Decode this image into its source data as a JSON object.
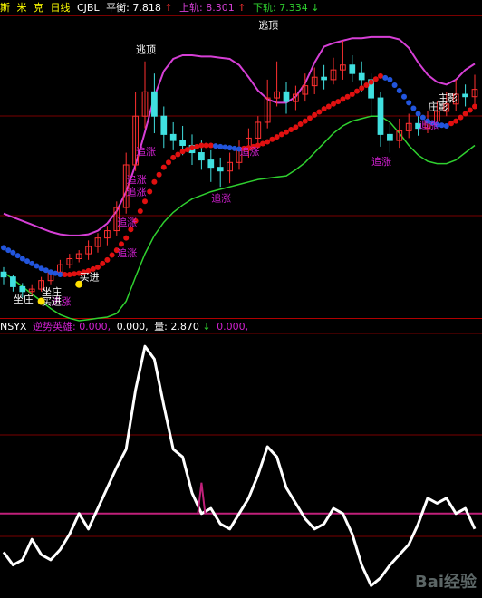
{
  "header": {
    "name_chars": [
      "斯",
      "米",
      "克"
    ],
    "period": "日线",
    "indicator": "CJBL",
    "balance_label": "平衡:",
    "balance_value": "7.818",
    "balance_arrow": "↑",
    "upper_label": "上轨:",
    "upper_value": "8.301",
    "upper_arrow": "↑",
    "lower_label": "下轨:",
    "lower_value": "7.334",
    "lower_arrow": "↓"
  },
  "sub_header": {
    "indicator": "NSYX",
    "name_label": "逆势英雄:",
    "v1": "0.000,",
    "v2": "0.000,",
    "vol_label": "量:",
    "vol_value": "2.870",
    "vol_arrow": "↓",
    "v4": "0.000,"
  },
  "colors": {
    "upper_band": "#d63fd6",
    "lower_band": "#2fd02f",
    "mid_up": "#e01010",
    "mid_down": "#2255dd",
    "candle_up": "#ff3030",
    "candle_down": "#40e0e0",
    "signal_text": "#d020d0",
    "buy_dot": "#ffe000",
    "osc_line": "#ffffff",
    "ref_line": "#c0207a",
    "grid": "#7a0000"
  },
  "annotations": [
    {
      "text": "逃顶",
      "color": "#ffffff"
    },
    {
      "text": "逃顶",
      "color": "#ffffff"
    },
    {
      "text": "追涨",
      "color": "#d020d0"
    },
    {
      "text": "追涨",
      "color": "#d020d0"
    },
    {
      "text": "追涨",
      "color": "#d020d0"
    },
    {
      "text": "追涨",
      "color": "#d020d0"
    },
    {
      "text": "追涨",
      "color": "#d020d0"
    },
    {
      "text": "追涨",
      "color": "#d020d0"
    },
    {
      "text": "追涨",
      "color": "#d020d0"
    },
    {
      "text": "追涨",
      "color": "#d020d0"
    },
    {
      "text": "追涨",
      "color": "#d020d0"
    },
    {
      "text": "追涨",
      "color": "#d020d0"
    },
    {
      "text": "买进",
      "color": "#ffffff"
    },
    {
      "text": "买进",
      "color": "#ffffff"
    },
    {
      "text": "坐庄",
      "color": "#ffffff"
    },
    {
      "text": "坐庄",
      "color": "#ffffff"
    },
    {
      "text": "庄影",
      "color": "#ffffff"
    },
    {
      "text": "庄影",
      "color": "#ffffff"
    }
  ],
  "watermark": "Bai经验",
  "chart_data": [
    {
      "type": "line",
      "indicator": "CJBL",
      "series": [
        {
          "name": "上轨",
          "last": 8.301
        },
        {
          "name": "平衡",
          "last": 7.818
        },
        {
          "name": "下轨",
          "last": 7.334
        }
      ],
      "upper": [
        7.3,
        7.27,
        7.24,
        7.21,
        7.18,
        7.15,
        7.13,
        7.12,
        7.12,
        7.13,
        7.16,
        7.22,
        7.32,
        7.48,
        7.7,
        7.97,
        8.26,
        8.47,
        8.57,
        8.6,
        8.6,
        8.59,
        8.59,
        8.58,
        8.57,
        8.52,
        8.42,
        8.31,
        8.24,
        8.21,
        8.21,
        8.26,
        8.37,
        8.54,
        8.67,
        8.7,
        8.72,
        8.74,
        8.74,
        8.75,
        8.75,
        8.75,
        8.73,
        8.66,
        8.54,
        8.44,
        8.38,
        8.36,
        8.4,
        8.48,
        8.53
      ],
      "mid": [
        7.02,
        6.98,
        6.93,
        6.89,
        6.85,
        6.82,
        6.8,
        6.8,
        6.81,
        6.83,
        6.86,
        6.92,
        7.0,
        7.1,
        7.24,
        7.4,
        7.56,
        7.68,
        7.76,
        7.81,
        7.84,
        7.86,
        7.86,
        7.85,
        7.84,
        7.83,
        7.84,
        7.86,
        7.89,
        7.93,
        7.97,
        8.01,
        8.06,
        8.11,
        8.16,
        8.2,
        8.24,
        8.28,
        8.33,
        8.38,
        8.43,
        8.4,
        8.31,
        8.21,
        8.12,
        8.06,
        8.03,
        8.02,
        8.06,
        8.12,
        8.18
      ],
      "lower": [
        6.82,
        6.76,
        6.7,
        6.64,
        6.58,
        6.52,
        6.47,
        6.44,
        6.42,
        6.43,
        6.44,
        6.45,
        6.48,
        6.58,
        6.78,
        6.97,
        7.12,
        7.23,
        7.31,
        7.37,
        7.42,
        7.45,
        7.48,
        7.5,
        7.52,
        7.54,
        7.56,
        7.58,
        7.59,
        7.6,
        7.61,
        7.66,
        7.72,
        7.8,
        7.88,
        7.96,
        8.02,
        8.06,
        8.08,
        8.1,
        8.1,
        8.05,
        7.96,
        7.86,
        7.78,
        7.73,
        7.71,
        7.71,
        7.74,
        7.8,
        7.86
      ],
      "candles": [
        {
          "o": 6.82,
          "c": 6.78,
          "h": 6.86,
          "l": 6.72
        },
        {
          "o": 6.78,
          "c": 6.7,
          "h": 6.8,
          "l": 6.66
        },
        {
          "o": 6.7,
          "c": 6.66,
          "h": 6.73,
          "l": 6.61
        },
        {
          "o": 6.66,
          "c": 6.68,
          "h": 6.72,
          "l": 6.62
        },
        {
          "o": 6.68,
          "c": 6.75,
          "h": 6.78,
          "l": 6.66
        },
        {
          "o": 6.75,
          "c": 6.82,
          "h": 6.84,
          "l": 6.72
        },
        {
          "o": 6.82,
          "c": 6.88,
          "h": 6.92,
          "l": 6.78
        },
        {
          "o": 6.88,
          "c": 6.93,
          "h": 6.97,
          "l": 6.85
        },
        {
          "o": 6.93,
          "c": 6.97,
          "h": 7.0,
          "l": 6.9
        },
        {
          "o": 6.97,
          "c": 7.03,
          "h": 7.08,
          "l": 6.92
        },
        {
          "o": 7.03,
          "c": 7.1,
          "h": 7.14,
          "l": 6.98
        },
        {
          "o": 7.1,
          "c": 7.16,
          "h": 7.2,
          "l": 7.04
        },
        {
          "o": 7.16,
          "c": 7.35,
          "h": 7.4,
          "l": 7.12
        },
        {
          "o": 7.35,
          "c": 7.7,
          "h": 7.8,
          "l": 7.3
        },
        {
          "o": 7.7,
          "c": 8.1,
          "h": 8.3,
          "l": 7.65
        },
        {
          "o": 8.1,
          "c": 8.3,
          "h": 8.55,
          "l": 8.0
        },
        {
          "o": 8.3,
          "c": 8.1,
          "h": 8.45,
          "l": 7.96
        },
        {
          "o": 8.1,
          "c": 7.95,
          "h": 8.18,
          "l": 7.84
        },
        {
          "o": 7.95,
          "c": 7.9,
          "h": 8.05,
          "l": 7.82
        },
        {
          "o": 7.9,
          "c": 7.86,
          "h": 8.02,
          "l": 7.78
        },
        {
          "o": 7.86,
          "c": 7.8,
          "h": 7.95,
          "l": 7.7
        },
        {
          "o": 7.8,
          "c": 7.74,
          "h": 7.9,
          "l": 7.66
        },
        {
          "o": 7.74,
          "c": 7.68,
          "h": 7.82,
          "l": 7.56
        },
        {
          "o": 7.68,
          "c": 7.65,
          "h": 7.76,
          "l": 7.52
        },
        {
          "o": 7.65,
          "c": 7.72,
          "h": 7.8,
          "l": 7.55
        },
        {
          "o": 7.72,
          "c": 7.82,
          "h": 7.9,
          "l": 7.66
        },
        {
          "o": 7.82,
          "c": 7.92,
          "h": 8.0,
          "l": 7.76
        },
        {
          "o": 7.92,
          "c": 8.05,
          "h": 8.1,
          "l": 7.85
        },
        {
          "o": 8.05,
          "c": 8.25,
          "h": 8.4,
          "l": 8.0
        },
        {
          "o": 8.25,
          "c": 8.3,
          "h": 8.55,
          "l": 8.18
        },
        {
          "o": 8.3,
          "c": 8.22,
          "h": 8.38,
          "l": 8.12
        },
        {
          "o": 8.22,
          "c": 8.28,
          "h": 8.35,
          "l": 8.15
        },
        {
          "o": 8.28,
          "c": 8.35,
          "h": 8.45,
          "l": 8.22
        },
        {
          "o": 8.35,
          "c": 8.42,
          "h": 8.5,
          "l": 8.28
        },
        {
          "o": 8.42,
          "c": 8.4,
          "h": 8.52,
          "l": 8.32
        },
        {
          "o": 8.4,
          "c": 8.48,
          "h": 8.58,
          "l": 8.36
        },
        {
          "o": 8.48,
          "c": 8.52,
          "h": 8.72,
          "l": 8.4
        },
        {
          "o": 8.52,
          "c": 8.45,
          "h": 8.6,
          "l": 8.38
        },
        {
          "o": 8.45,
          "c": 8.4,
          "h": 8.55,
          "l": 8.3
        },
        {
          "o": 8.4,
          "c": 8.25,
          "h": 8.45,
          "l": 8.1
        },
        {
          "o": 8.25,
          "c": 7.95,
          "h": 8.3,
          "l": 7.85
        },
        {
          "o": 7.95,
          "c": 7.9,
          "h": 8.05,
          "l": 7.8
        },
        {
          "o": 7.9,
          "c": 7.98,
          "h": 8.08,
          "l": 7.84
        },
        {
          "o": 7.98,
          "c": 8.04,
          "h": 8.12,
          "l": 7.92
        },
        {
          "o": 8.04,
          "c": 8.0,
          "h": 8.1,
          "l": 7.94
        },
        {
          "o": 8.0,
          "c": 8.06,
          "h": 8.14,
          "l": 7.96
        },
        {
          "o": 8.06,
          "c": 8.14,
          "h": 8.22,
          "l": 8.02
        },
        {
          "o": 8.14,
          "c": 8.2,
          "h": 8.3,
          "l": 8.1
        },
        {
          "o": 8.2,
          "c": 8.28,
          "h": 8.4,
          "l": 8.14
        },
        {
          "o": 8.28,
          "c": 8.26,
          "h": 8.36,
          "l": 8.18
        },
        {
          "o": 8.26,
          "c": 8.32,
          "h": 8.44,
          "l": 8.2
        }
      ],
      "ylim": [
        6.45,
        8.92
      ]
    },
    {
      "type": "line",
      "indicator": "NSYX",
      "series": [
        {
          "name": "逆势英雄",
          "last": 0.0
        }
      ],
      "values": [
        0.15,
        0.1,
        0.12,
        0.2,
        0.14,
        0.12,
        0.16,
        0.22,
        0.3,
        0.24,
        0.32,
        0.4,
        0.48,
        0.55,
        0.78,
        0.95,
        0.9,
        0.72,
        0.55,
        0.52,
        0.38,
        0.3,
        0.32,
        0.26,
        0.24,
        0.3,
        0.36,
        0.45,
        0.56,
        0.52,
        0.4,
        0.34,
        0.28,
        0.24,
        0.26,
        0.32,
        0.3,
        0.22,
        0.1,
        0.02,
        0.05,
        0.1,
        0.14,
        0.18,
        0.26,
        0.36,
        0.34,
        0.36,
        0.3,
        0.32,
        0.24
      ],
      "ref": 0.3,
      "ylim": [
        0.0,
        1.0
      ]
    }
  ]
}
